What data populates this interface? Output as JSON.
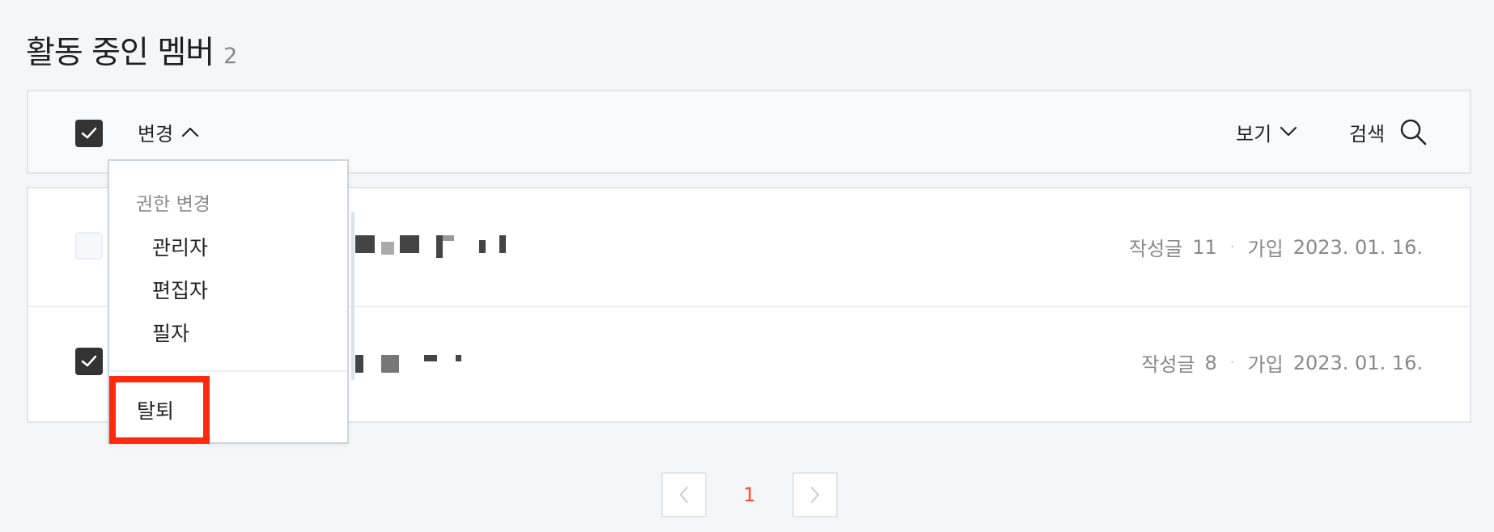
{
  "header": {
    "title": "활동 중인 멤버",
    "count": "2"
  },
  "toolbar": {
    "select_all_checked": true,
    "change_label": "변경",
    "view_label": "보기",
    "search_label": "검색"
  },
  "dropdown": {
    "section_header": "권한 변경",
    "items": [
      {
        "label": "관리자"
      },
      {
        "label": "편집자"
      },
      {
        "label": "필자"
      }
    ],
    "leave_label": "탈퇴"
  },
  "members": [
    {
      "checked": false,
      "posts_label": "작성글",
      "posts_count": "11",
      "separator": "·",
      "joined_label": "가입",
      "joined_date": "2023. 01. 16."
    },
    {
      "checked": true,
      "posts_label": "작성글",
      "posts_count": "8",
      "separator": "·",
      "joined_label": "가입",
      "joined_date": "2023. 01. 16."
    }
  ],
  "pagination": {
    "current_page": "1"
  },
  "colors": {
    "accent": "#ff4a2b",
    "highlight_box": "#ff2a0d",
    "checkbox_checked": "#333333"
  }
}
